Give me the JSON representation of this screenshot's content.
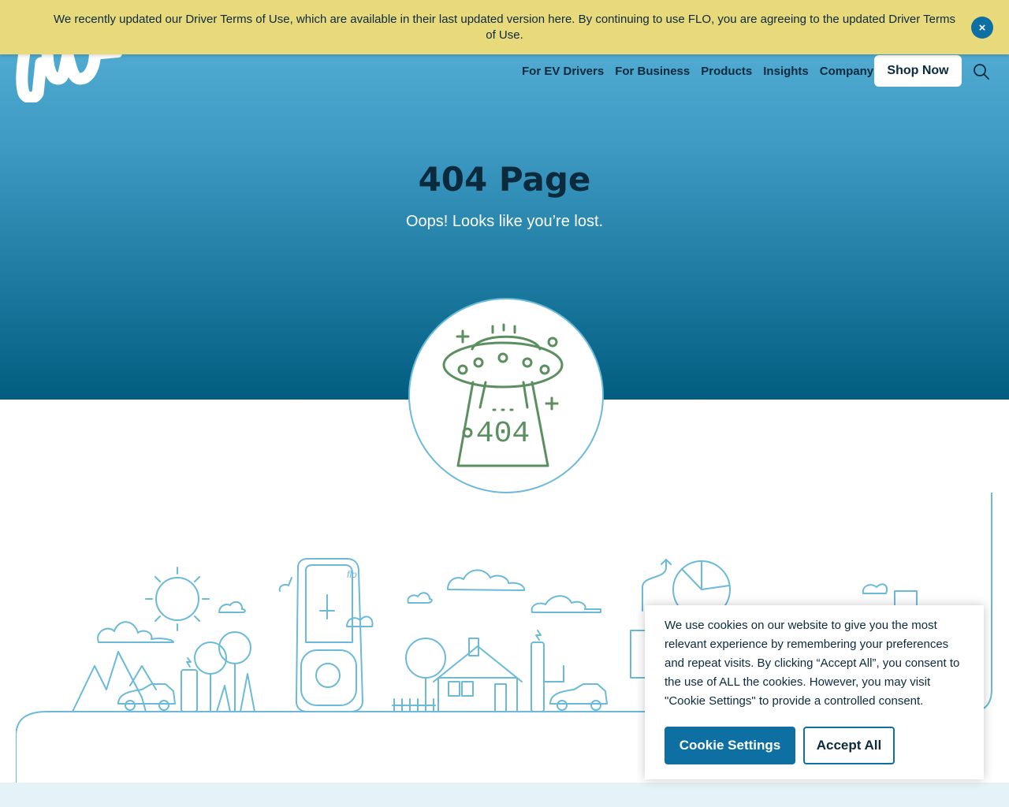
{
  "announcement": {
    "text": "We recently updated our Driver Terms of Use, which are available in their last updated version here. By continuing to use FLO, you are agreeing to the updated Driver Terms of Use.",
    "close_label": "×"
  },
  "header": {
    "logo_text": "flo",
    "nav": [
      {
        "label": "For EV Drivers"
      },
      {
        "label": "For Business"
      },
      {
        "label": "Products"
      },
      {
        "label": "Insights"
      },
      {
        "label": "Company"
      }
    ],
    "shop_label": "Shop Now",
    "search_icon": "search-icon"
  },
  "hero": {
    "title": "404 Page",
    "subtitle": "Oops! Looks like you’re lost."
  },
  "illustration": {
    "ufo_label": "404",
    "charger_label": "flo"
  },
  "cookie": {
    "text": "We use cookies on our website to give you the most relevant experience by remembering your preferences and repeat visits. By clicking “Accept All”, you consent to the use of ALL the cookies. However, you may visit \"Cookie Settings\" to provide a controlled consent.",
    "settings_label": "Cookie Settings",
    "accept_label": "Accept All"
  },
  "colors": {
    "announce_bg": "#e8d97b",
    "accent": "#0e6fa3",
    "hero_top": "#5ab3d9",
    "hero_bottom": "#025d80",
    "ufo_green": "#5b8f5f",
    "line_blue": "#6bbad8"
  }
}
